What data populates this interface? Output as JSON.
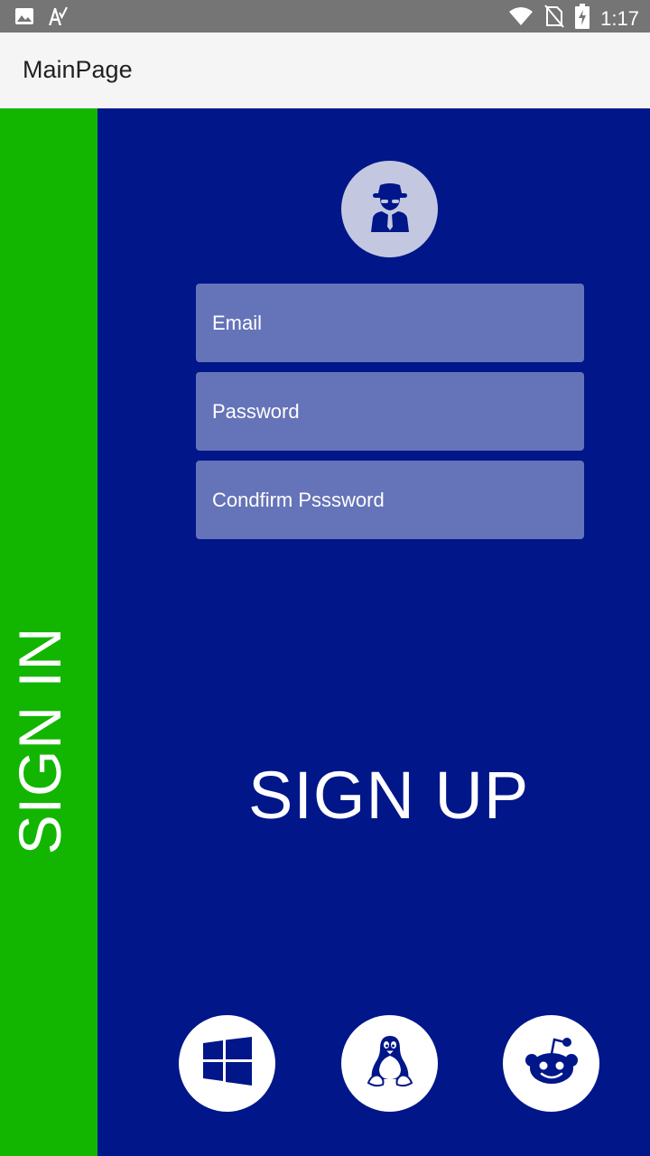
{
  "status_bar": {
    "time": "1:17",
    "icons": [
      "image-icon",
      "text-a-icon",
      "wifi-icon",
      "no-sim-icon",
      "battery-charging-icon"
    ]
  },
  "app_bar": {
    "title": "MainPage"
  },
  "side_panel": {
    "label": "SIGN IN"
  },
  "form": {
    "avatar_icon": "spy-icon",
    "email_placeholder": "Email",
    "password_placeholder": "Password",
    "confirm_password_placeholder": "Condfirm Psssword"
  },
  "signup": {
    "title": "SIGN UP"
  },
  "social": [
    "windows-icon",
    "linux-icon",
    "reddit-icon"
  ],
  "colors": {
    "status_bar": "#757575",
    "app_bar": "#f5f5f5",
    "side_panel": "#12b600",
    "main_panel": "#001689",
    "field": "#6574b9",
    "avatar_circle": "#c3c8e0"
  }
}
